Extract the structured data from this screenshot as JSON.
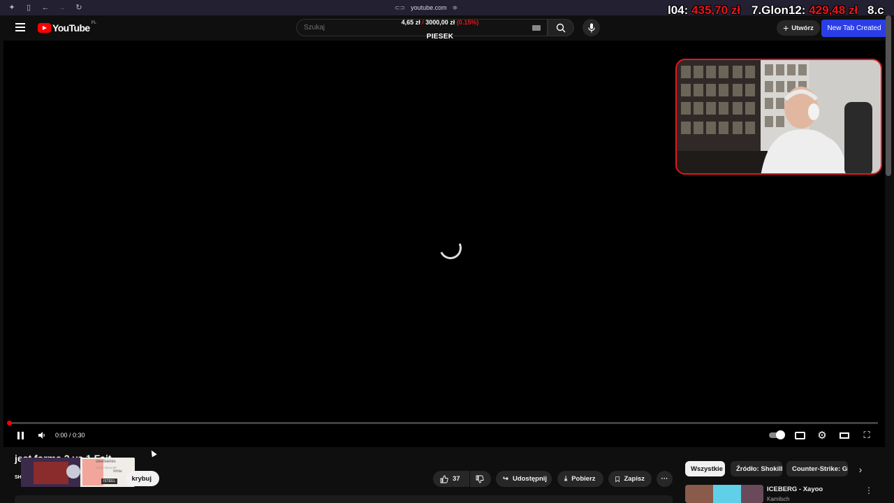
{
  "browser": {
    "url": "youtube.com",
    "icons": [
      "menu-icon",
      "sidebar-icon",
      "back-icon",
      "forward-icon",
      "reload-icon"
    ]
  },
  "overlay": {
    "left_prefix": "l04:",
    "left_amount": "435,70 zł",
    "mid_prefix": "7.Glon12:",
    "mid_amount": "429,48 zł",
    "right_text": "8.c"
  },
  "header": {
    "logo_text": "YouTube",
    "country_code": "PL",
    "search_placeholder": "Szukaj",
    "create_label": "Utwórz",
    "new_tab_label": "New Tab Created"
  },
  "donation": {
    "current": "4,65 zł",
    "separator": "/",
    "goal": "3000,00 zł",
    "percent": "(0.15%)",
    "name": "PIESEK"
  },
  "player": {
    "time": "0:00 / 0:30",
    "progress_fraction": 0.0,
    "state": "loading"
  },
  "video": {
    "title": "jest forma 2 vs 1 Fajt",
    "channel_initial": "SH",
    "subscribe_label": "krybuj",
    "like_count": "37",
    "share_label": "Udostępnij",
    "download_label": "Pobierz",
    "save_label": "Zapisz",
    "more_label": "···"
  },
  "ad": {
    "brand": "steelseries",
    "product_line": "Arctis Nova 5P",
    "color_label": "White",
    "shop_label": "ISTEEL"
  },
  "chips": {
    "all": "Wszystkie",
    "source": "Źródło: Shokill",
    "counter_strike": "Counter-Strike: Gl"
  },
  "recommendation": {
    "title": "ICEBERG - Xayoo",
    "channel": "Kamilsch"
  },
  "colors": {
    "youtube_red": "#ff0000",
    "overlay_red": "#e8161c",
    "new_tab_blue": "#2b3de6"
  }
}
